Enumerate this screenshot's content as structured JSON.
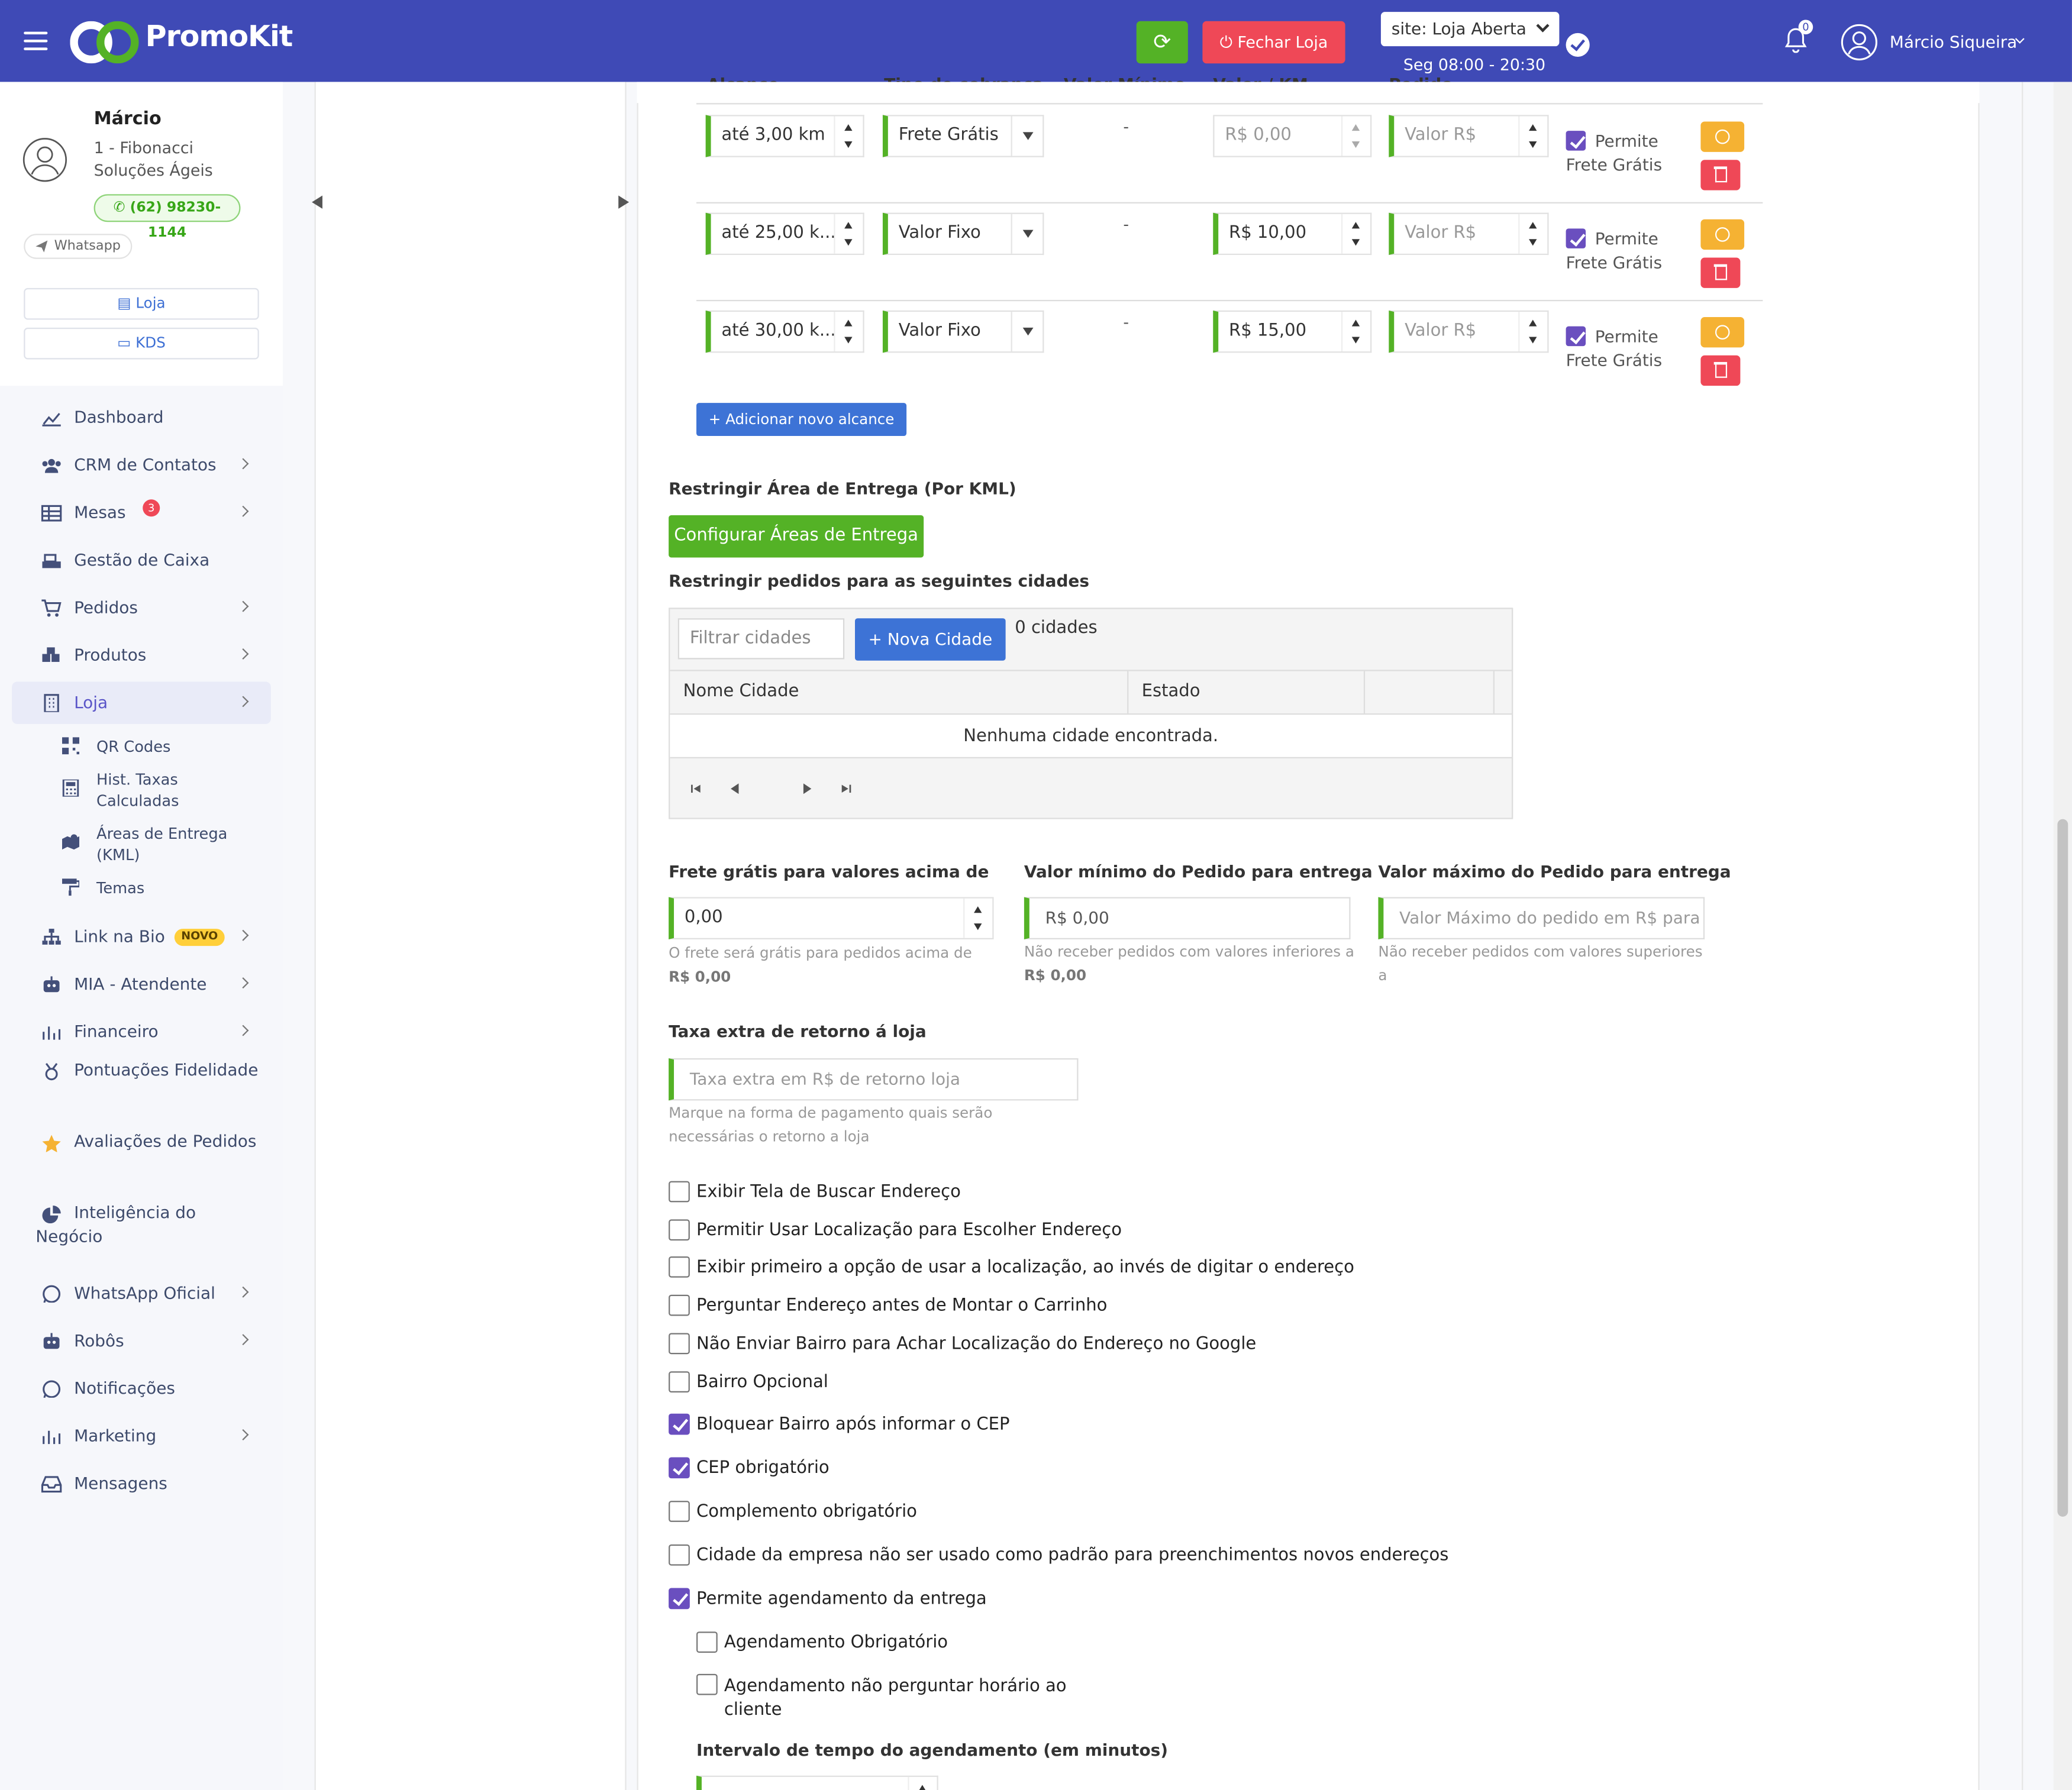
{
  "app": {
    "logo": "PromoKit",
    "site_status": "site: Loja Aberta",
    "hours": "Seg 08:00 - 20:30",
    "close_store": "Fechar Loja",
    "notifications": "0",
    "user": "Márcio Siqueira"
  },
  "colors": {
    "topbar": "#3f4ab6",
    "green": "#54b226",
    "red": "#ef4857",
    "blue": "#3d73d6",
    "yellow": "#f5b233",
    "purple": "#6a4fbf"
  },
  "profile": {
    "name": "Márcio",
    "company": "1 - Fibonacci Soluções Ágeis",
    "phone": "(62) 98230-1144",
    "whatsapp": "Whatsapp",
    "btn_loja": "Loja",
    "btn_kds": "KDS"
  },
  "nav": [
    {
      "label": "Dashboard",
      "icon": "chart-line-icon"
    },
    {
      "label": "CRM de Contatos",
      "icon": "users-icon"
    },
    {
      "label": "Mesas",
      "icon": "table-icon",
      "badge": "3"
    },
    {
      "label": "Gestão de Caixa",
      "icon": "cash-register-icon"
    },
    {
      "label": "Pedidos",
      "icon": "cart-icon"
    },
    {
      "label": "Produtos",
      "icon": "boxes-icon"
    },
    {
      "label": "Loja",
      "icon": "building-icon"
    },
    {
      "label": "Link na Bio",
      "icon": "sitemap-icon",
      "badge": "NOVO"
    },
    {
      "label": "MIA - Atendente",
      "icon": "robot-icon"
    },
    {
      "label": "Financeiro",
      "icon": "bar-chart-icon"
    },
    {
      "label": "Pontuações Fidelidade",
      "icon": "award-icon"
    },
    {
      "label": "Avaliações de Pedidos",
      "icon": "star-icon"
    },
    {
      "label": "Inteligência do Negócio",
      "icon": "pie-chart-icon"
    },
    {
      "label": "WhatsApp Oficial",
      "icon": "whatsapp-icon"
    },
    {
      "label": "Robôs",
      "icon": "robot-icon"
    },
    {
      "label": "Notificações",
      "icon": "whatsapp-icon"
    },
    {
      "label": "Marketing",
      "icon": "bar-chart-icon"
    },
    {
      "label": "Mensagens",
      "icon": "inbox-icon"
    }
  ],
  "subnav": [
    {
      "label": "QR Codes",
      "icon": "qrcode-icon"
    },
    {
      "label": "Hist. Taxas Calculadas",
      "icon": "calculator-icon"
    },
    {
      "label": "Áreas de Entrega (KML)",
      "icon": "map-icon"
    },
    {
      "label": "Temas",
      "icon": "paint-roller-icon"
    }
  ],
  "range_table": {
    "headers": [
      "Alcance",
      "Tipo de cobrança",
      "Valor Mínimo",
      "Valor / KM",
      "Pedido"
    ],
    "rows": [
      {
        "alcance": "até 3,00 km",
        "tipo": "Frete Grátis",
        "minimo": "-",
        "valor_km": "R$ 0,00",
        "pedido": "Valor R$",
        "permite": "Permite Frete Grátis"
      },
      {
        "alcance": "até 25,00 k...",
        "tipo": "Valor Fixo",
        "minimo": "-",
        "valor_km": "R$ 10,00",
        "pedido": "Valor R$",
        "permite": "Permite Frete Grátis"
      },
      {
        "alcance": "até 30,00 k...",
        "tipo": "Valor Fixo",
        "minimo": "-",
        "valor_km": "R$ 15,00",
        "pedido": "Valor R$",
        "permite": "Permite Frete Grátis"
      }
    ],
    "add_button": "+ Adicionar novo alcance"
  },
  "kml": {
    "label": "Restringir Área de Entrega (Por KML)",
    "button": "Configurar Áreas de Entrega"
  },
  "cities": {
    "label": "Restringir pedidos para as seguintes cidades",
    "filter_placeholder": "Filtrar cidades",
    "new_button": "+ Nova Cidade",
    "count": "0 cidades",
    "col_name": "Nome Cidade",
    "col_state": "Estado",
    "empty": "Nenhuma cidade encontrada."
  },
  "fields": {
    "frete_gratis": {
      "label": "Frete grátis para valores acima de",
      "value": "0,00",
      "help": "O frete será grátis para pedidos acima de",
      "help_value": "R$ 0,00"
    },
    "valor_minimo": {
      "label": "Valor mínimo do Pedido para entrega",
      "value": "R$ 0,00",
      "help": "Não receber pedidos com valores inferiores a",
      "help_value": "R$ 0,00"
    },
    "valor_maximo": {
      "label": "Valor máximo do Pedido para entrega",
      "placeholder": "Valor Máximo do pedido em R$ para",
      "help": "Não receber pedidos com valores superiores a"
    },
    "taxa_retorno": {
      "label": "Taxa extra de retorno á loja",
      "placeholder": "Taxa extra em R$ de retorno loja",
      "help": "Marque na forma de pagamento quais serão necessárias o retorno a loja"
    }
  },
  "options": [
    {
      "label": "Exibir Tela de Buscar Endereço",
      "checked": false
    },
    {
      "label": "Permitir Usar Localização para Escolher Endereço",
      "checked": false
    },
    {
      "label": "Exibir primeiro a opção de usar a localização, ao invés de digitar o endereço",
      "checked": false
    },
    {
      "label": "Perguntar Endereço antes de Montar o Carrinho",
      "checked": false
    },
    {
      "label": "Não Enviar Bairro para Achar Localização do Endereço no Google",
      "checked": false
    },
    {
      "label": "Bairro Opcional",
      "checked": false
    },
    {
      "label": "Bloquear Bairro após informar o CEP",
      "checked": true
    },
    {
      "label": "CEP obrigatório",
      "checked": true
    },
    {
      "label": "Complemento obrigatório",
      "checked": false
    },
    {
      "label": "Cidade da empresa não ser usado como padrão para preenchimentos novos endereços",
      "checked": false
    },
    {
      "label": "Permite agendamento da entrega",
      "checked": true
    }
  ],
  "sub_options": [
    {
      "label": "Agendamento Obrigatório",
      "checked": false
    },
    {
      "label": "Agendamento não perguntar horário ao cliente",
      "checked": false
    }
  ],
  "interval_label": "Intervalo de tempo do agendamento (em minutos)"
}
